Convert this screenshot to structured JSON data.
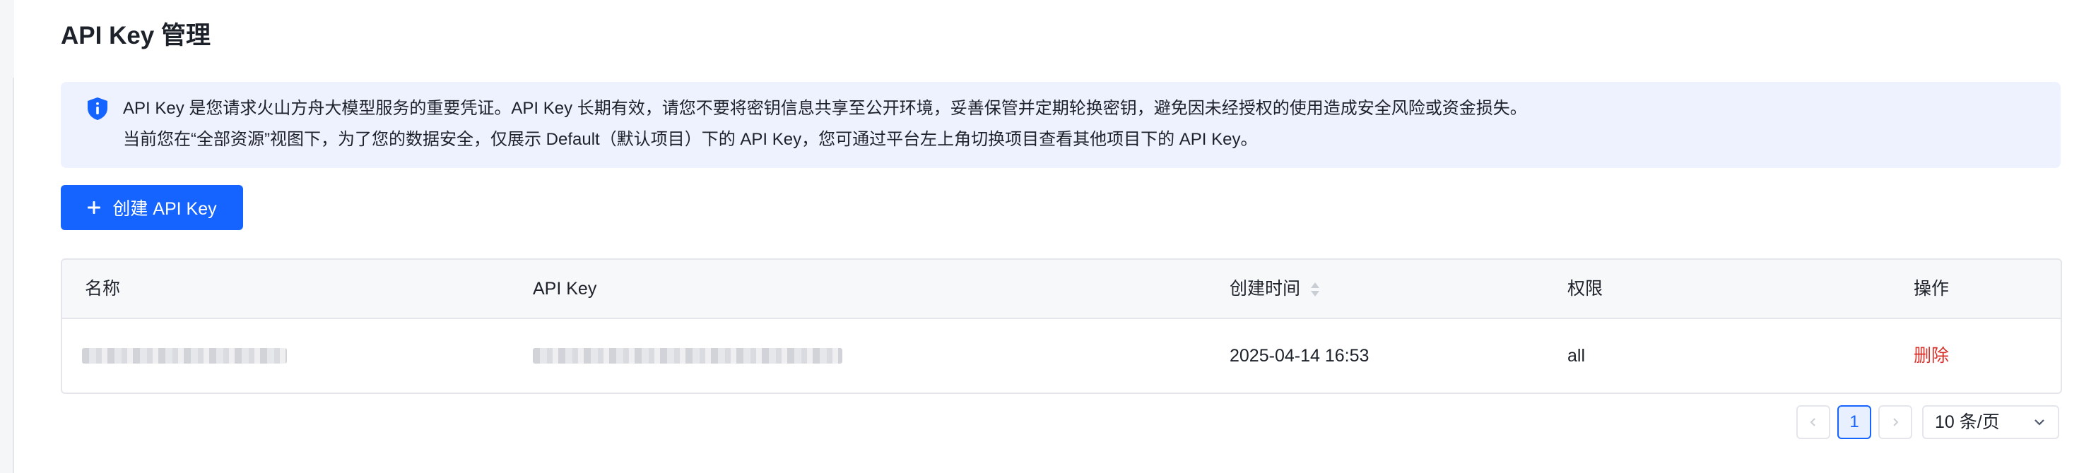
{
  "page": {
    "title": "API Key 管理"
  },
  "notice": {
    "icon": "shield-info-icon",
    "line1": "API Key 是您请求火山方舟大模型服务的重要凭证。API Key 长期有效，请您不要将密钥信息共享至公开环境，妥善保管并定期轮换密钥，避免因未经授权的使用造成安全风险或资金损失。",
    "line2": "当前您在“全部资源”视图下，为了您的数据安全，仅展示 Default（默认项目）下的 API Key，您可通过平台左上角切换项目查看其他项目下的 API Key。"
  },
  "toolbar": {
    "create_icon": "plus-icon",
    "create_label": "创建 API Key"
  },
  "table": {
    "columns": {
      "name": "名称",
      "api_key": "API Key",
      "created_at": "创建时间",
      "permission": "权限",
      "actions": "操作"
    },
    "rows": [
      {
        "name": "",
        "api_key": "",
        "created_at": "2025-04-14 16:53",
        "permission": "all",
        "delete_label": "删除"
      }
    ]
  },
  "pagination": {
    "prev_icon": "chevron-left-icon",
    "current_page": "1",
    "next_icon": "chevron-right-icon",
    "page_size": "10 条/页",
    "page_size_icon": "chevron-down-icon"
  },
  "colors": {
    "primary": "#1664ff",
    "danger": "#d7312a",
    "notice_bg": "#eef1fe"
  }
}
